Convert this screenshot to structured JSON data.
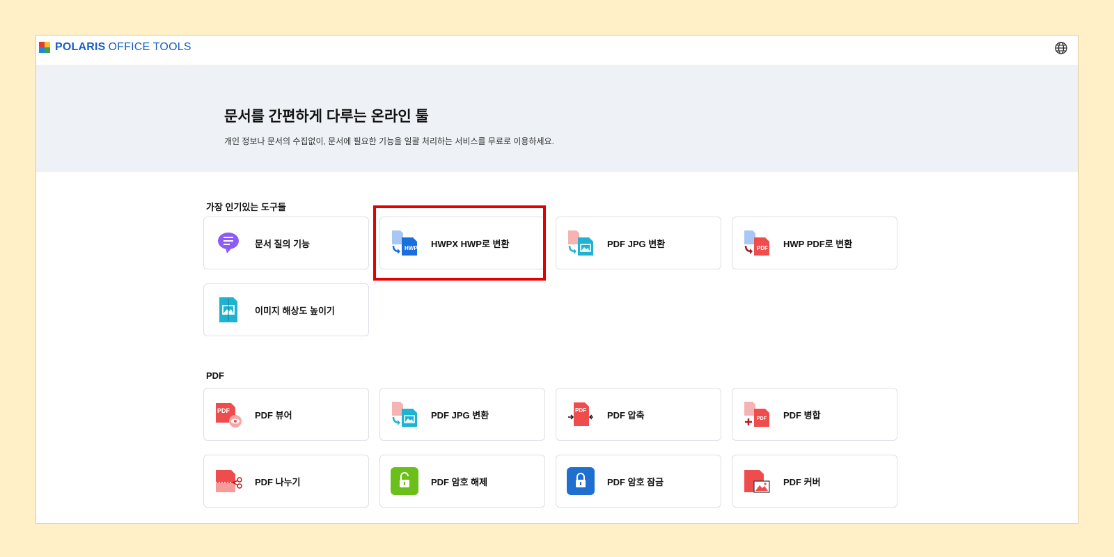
{
  "header": {
    "brand": "POLARIS",
    "brand_sub": "OFFICE TOOLS",
    "logo_colors": [
      "#e53935",
      "#fbc02d",
      "#1e88e5",
      "#43a047"
    ]
  },
  "hero": {
    "title": "문서를 간편하게 다루는 온라인 툴",
    "subtitle": "개인 정보나 문서의 수집없이, 문서에 필요한 기능을 일괄 처리하는 서비스를 무료로 이용하세요."
  },
  "popular": {
    "title": "가장 인기있는 도구들",
    "items": [
      {
        "label": "문서 질의 기능",
        "icon": "chat-bubble-icon"
      },
      {
        "label": "HWPX HWP로 변환",
        "icon": "hwpx-to-hwp-icon"
      },
      {
        "label": "PDF JPG 변환",
        "icon": "pdf-to-jpg-icon"
      },
      {
        "label": "HWP PDF로 변환",
        "icon": "hwp-to-pdf-icon"
      },
      {
        "label": "이미지 해상도 높이기",
        "icon": "image-upscale-icon"
      }
    ]
  },
  "pdf": {
    "title": "PDF",
    "items": [
      {
        "label": "PDF 뷰어",
        "icon": "pdf-viewer-icon"
      },
      {
        "label": "PDF JPG 변환",
        "icon": "pdf-to-jpg-icon"
      },
      {
        "label": "PDF 압축",
        "icon": "pdf-compress-icon"
      },
      {
        "label": "PDF 병합",
        "icon": "pdf-merge-icon"
      },
      {
        "label": "PDF 나누기",
        "icon": "pdf-split-icon"
      },
      {
        "label": "PDF 암호 해제",
        "icon": "unlock-icon"
      },
      {
        "label": "PDF 암호 잠금",
        "icon": "lock-icon"
      },
      {
        "label": "PDF 커버",
        "icon": "pdf-cover-icon"
      }
    ]
  },
  "icon_text": {
    "hwp": "HWP",
    "pdf": "PDF"
  },
  "colors": {
    "highlight": "#e60000",
    "brand": "#1a5fc4",
    "hero_bg": "#eef1f6",
    "pdf_red": "#ef4d4d",
    "jpg_teal": "#1fb3d2",
    "unlock_green": "#6bbf1a",
    "lock_blue": "#1f6fd1",
    "chat_purple": "#8b5cf6"
  }
}
